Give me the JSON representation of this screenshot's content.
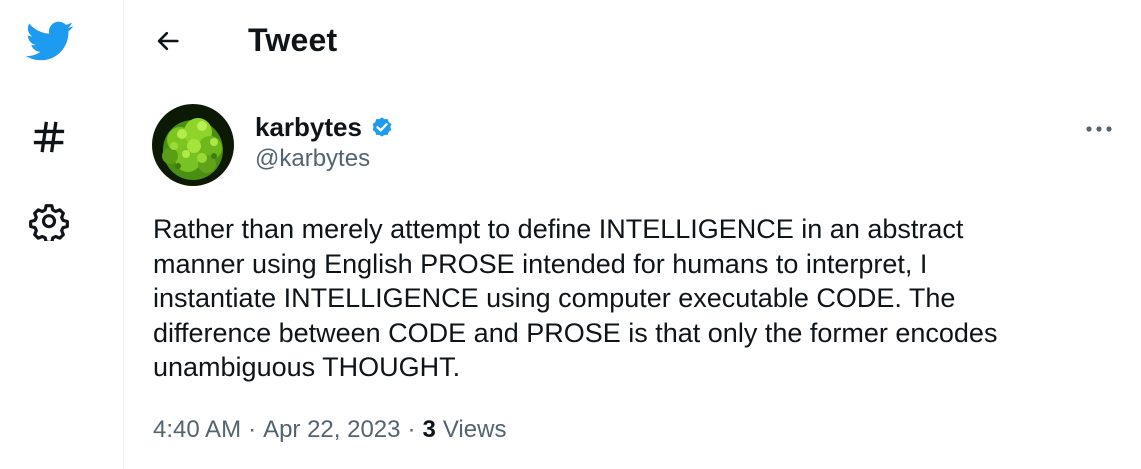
{
  "nav": {
    "items": [
      {
        "icon": "twitter-bird-icon"
      },
      {
        "icon": "hashtag-icon"
      },
      {
        "icon": "gear-icon"
      }
    ]
  },
  "header": {
    "back_icon": "arrow-left-icon",
    "title": "Tweet"
  },
  "tweet": {
    "author": {
      "display_name": "karbytes",
      "verified": true,
      "handle": "@karbytes"
    },
    "text": "Rather than merely attempt to define INTELLIGENCE in an abstract\nmanner using English PROSE intended for humans to interpret, I\ninstantiate INTELLIGENCE using computer executable CODE. The\ndifference between CODE and PROSE is that only the former encodes\nunambiguous THOUGHT.",
    "time": "4:40 AM",
    "separator": "·",
    "date": "Apr 22, 2023",
    "views_count": "3",
    "views_label": "Views"
  },
  "colors": {
    "brand_blue": "#1d9bf0",
    "text_primary": "#0f1419",
    "text_secondary": "#536471",
    "border": "#eff3f4"
  }
}
